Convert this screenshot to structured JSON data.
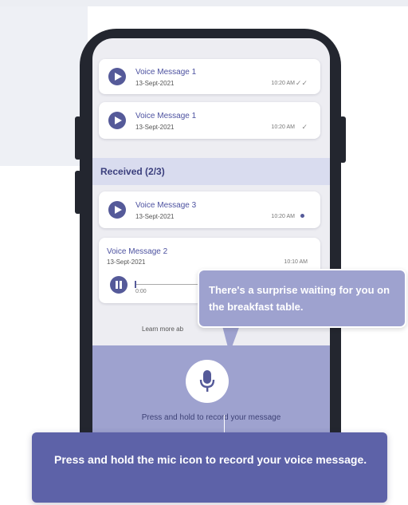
{
  "sent_messages": [
    {
      "title": "Voice Message 1",
      "date": "13-Sept-2021",
      "time": "10:20 AM",
      "status": "✓✓"
    },
    {
      "title": "Voice Message 1",
      "date": "13-Sept-2021",
      "time": "10:20 AM",
      "status": "✓"
    }
  ],
  "received_section": {
    "label": "Received (2/3)"
  },
  "received_messages": [
    {
      "title": "Voice Message 3",
      "date": "13-Sept-2021",
      "time": "10:20 AM"
    },
    {
      "title": "Voice Message 2",
      "date": "13-Sept-2021",
      "time": "10:10 AM",
      "elapsed": "0:00"
    }
  ],
  "learn_more": "Learn more ab",
  "mic": {
    "icon": "microphone-icon",
    "hint": "Press and hold to record your message"
  },
  "tooltip": {
    "text": "There's a surprise waiting for you on the breakfast table."
  },
  "banner": {
    "text": "Press and hold the mic icon to record your voice message."
  },
  "colors": {
    "accent": "#555a99",
    "record_area": "#9ea2cf",
    "banner": "#5d62a8",
    "phone_frame": "#23262f"
  }
}
